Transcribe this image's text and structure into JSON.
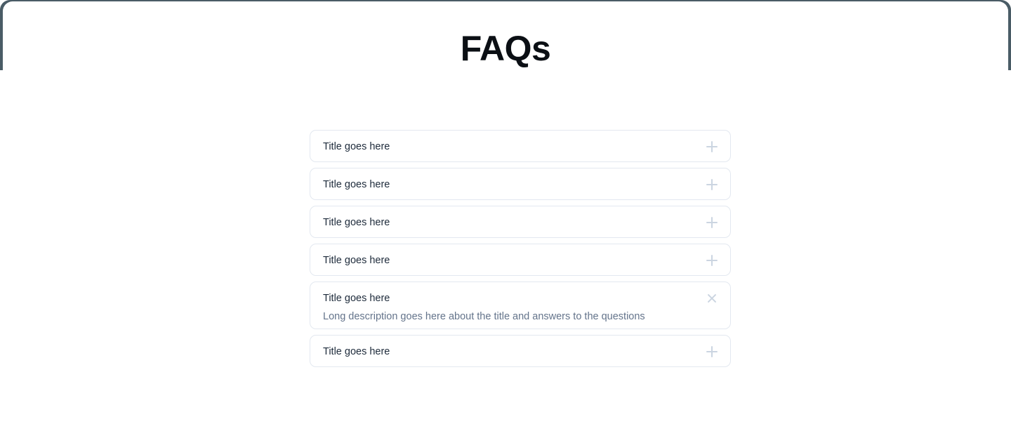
{
  "page": {
    "title": "FAQs",
    "accent_dark": "#4a5c66",
    "card_border": "#e3e8f0",
    "title_color": "#1e2b3b",
    "desc_color": "#64748b",
    "icon_color": "#cbd5e1"
  },
  "faq": {
    "items": [
      {
        "title": "Title goes here",
        "expanded": false,
        "icon": "plus-icon",
        "description": ""
      },
      {
        "title": "Title goes here",
        "expanded": false,
        "icon": "plus-icon",
        "description": ""
      },
      {
        "title": "Title goes here",
        "expanded": false,
        "icon": "plus-icon",
        "description": ""
      },
      {
        "title": "Title goes here",
        "expanded": false,
        "icon": "plus-icon",
        "description": ""
      },
      {
        "title": "Title goes here",
        "expanded": true,
        "icon": "close-icon",
        "description": "Long description goes here about the title and answers to the questions"
      },
      {
        "title": "Title goes here",
        "expanded": false,
        "icon": "plus-icon",
        "description": ""
      }
    ]
  }
}
